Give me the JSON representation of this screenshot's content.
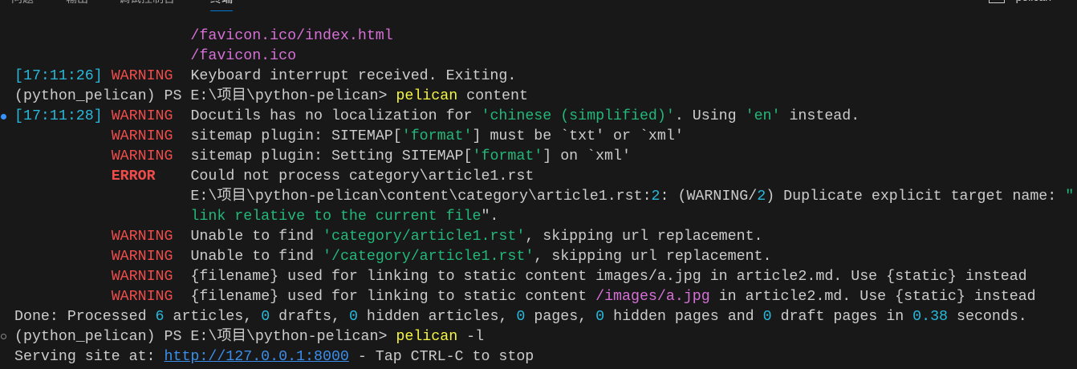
{
  "tabs": [
    {
      "label": "问题"
    },
    {
      "label": "输出"
    },
    {
      "label": "调试控制台"
    },
    {
      "label": "终端",
      "active": true
    }
  ],
  "terminal_toolbar": {
    "add_icon": "+",
    "terminal_name": "pelican",
    "terminal_icon": "terminal-icon"
  },
  "colors": {
    "w": "#cccccc",
    "r": "#f14c4c",
    "rb": "#f14c4c",
    "c": "#29b8db",
    "g": "#23b87a",
    "m": "#d670d6",
    "y": "#f5f543",
    "l": "#3b8eea"
  },
  "lines": [
    [
      [
        "                    ",
        "w"
      ],
      [
        "/favicon.ico/index.html",
        "m"
      ]
    ],
    [
      [
        "                    ",
        "w"
      ],
      [
        "/favicon.ico",
        "m"
      ]
    ],
    [
      [
        "[17:11:26] ",
        "c"
      ],
      [
        "WARNING  ",
        "r"
      ],
      [
        "Keyboard interrupt received. Exiting.",
        "w"
      ]
    ],
    [
      [
        "(python_pelican) PS E:\\项目\\python-pelican> ",
        "w"
      ],
      [
        "pelican",
        "y"
      ],
      [
        " content",
        "w"
      ]
    ],
    [
      [
        "[17:11:28] ",
        "c"
      ],
      [
        "WARNING  ",
        "r"
      ],
      [
        "Docutils has no localization for ",
        "w"
      ],
      [
        "'chinese (simplified)'",
        "g"
      ],
      [
        ". Using ",
        "w"
      ],
      [
        "'en'",
        "g"
      ],
      [
        " instead.",
        "w"
      ]
    ],
    [
      [
        "           ",
        "w"
      ],
      [
        "WARNING  ",
        "r"
      ],
      [
        "sitemap plugin: SITEMAP[",
        "w"
      ],
      [
        "'format'",
        "g"
      ],
      [
        "] must be `txt' or `xml'",
        "w"
      ]
    ],
    [
      [
        "           ",
        "w"
      ],
      [
        "WARNING  ",
        "r"
      ],
      [
        "sitemap plugin: Setting SITEMAP[",
        "w"
      ],
      [
        "'format'",
        "g"
      ],
      [
        "] on `xml'",
        "w"
      ]
    ],
    [
      [
        "           ",
        "w"
      ],
      [
        "ERROR    ",
        "rb"
      ],
      [
        "Could not process category\\article1.rst",
        "w"
      ]
    ],
    [
      [
        "                    ",
        "w"
      ],
      [
        "E:\\项目\\python-pelican\\content\\category\\article1.rst:",
        "w"
      ],
      [
        "2",
        "c"
      ],
      [
        ": (WARNING/",
        "w"
      ],
      [
        "2",
        "c"
      ],
      [
        ") Duplicate explicit target name: ",
        "w"
      ],
      [
        "\"",
        "g"
      ]
    ],
    [
      [
        "                    ",
        "w"
      ],
      [
        "link relative to the current file",
        "g"
      ],
      [
        "\".",
        "w"
      ]
    ],
    [
      [
        "           ",
        "w"
      ],
      [
        "WARNING  ",
        "r"
      ],
      [
        "Unable to find ",
        "w"
      ],
      [
        "'category/article1.rst'",
        "g"
      ],
      [
        ", skipping url replacement.",
        "w"
      ]
    ],
    [
      [
        "           ",
        "w"
      ],
      [
        "WARNING  ",
        "r"
      ],
      [
        "Unable to find ",
        "w"
      ],
      [
        "'/category/article1.rst'",
        "g"
      ],
      [
        ", skipping url replacement.",
        "w"
      ]
    ],
    [
      [
        "           ",
        "w"
      ],
      [
        "WARNING  ",
        "r"
      ],
      [
        "{filename} used for linking to static content images/a.jpg in article2.md. Use {static} instead",
        "w"
      ]
    ],
    [
      [
        "           ",
        "w"
      ],
      [
        "WARNING  ",
        "r"
      ],
      [
        "{filename} used for linking to static content ",
        "w"
      ],
      [
        "/images/a.jpg",
        "m"
      ],
      [
        " in article2.md. Use {static} instead",
        "w"
      ]
    ],
    [
      [
        "Done: Processed ",
        "w"
      ],
      [
        "6",
        "c"
      ],
      [
        " articles, ",
        "w"
      ],
      [
        "0",
        "c"
      ],
      [
        " drafts, ",
        "w"
      ],
      [
        "0",
        "c"
      ],
      [
        " hidden articles, ",
        "w"
      ],
      [
        "0",
        "c"
      ],
      [
        " pages, ",
        "w"
      ],
      [
        "0",
        "c"
      ],
      [
        " hidden pages and ",
        "w"
      ],
      [
        "0",
        "c"
      ],
      [
        " draft pages in ",
        "w"
      ],
      [
        "0.38",
        "c"
      ],
      [
        " seconds.",
        "w"
      ]
    ],
    [
      [
        "(python_pelican) PS E:\\项目\\python-pelican> ",
        "w"
      ],
      [
        "pelican",
        "y"
      ],
      [
        " -l",
        "w"
      ]
    ],
    [
      [
        "Serving site at: ",
        "w"
      ],
      [
        "http://127.0.0.1:8000",
        "l"
      ],
      [
        " - Tap CTRL-C to stop",
        "w"
      ]
    ]
  ]
}
